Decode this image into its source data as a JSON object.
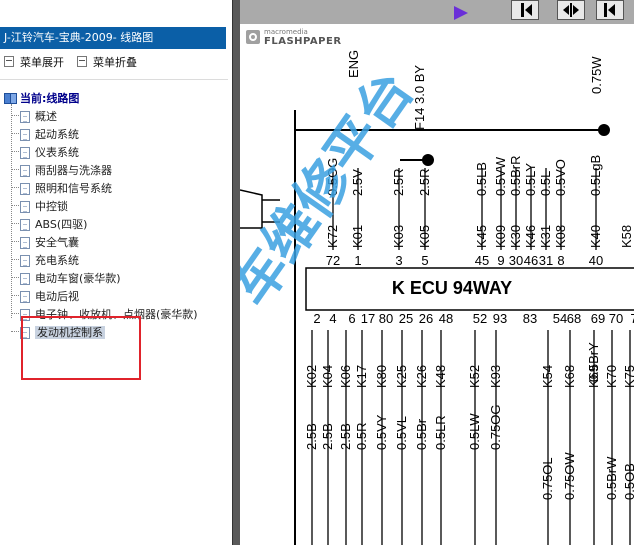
{
  "window": {
    "title": "J-江铃汽车-宝典-2009- 线路图"
  },
  "menu_controls": {
    "expand": "菜单展开",
    "collapse": "菜单折叠"
  },
  "tree": {
    "root": "当前:线路图",
    "items": [
      "概述",
      "起动系统",
      "仪表系统",
      "雨刮器与洗涤器",
      "照明和信号系统",
      "中控锁",
      "ABS(四驱)",
      "安全气囊",
      "充电系统",
      "电动车窗(豪华款)",
      "电动后视",
      "电子钟、收放机、点烟器(豪华款)",
      "发动机控制系"
    ],
    "selected_index": 12
  },
  "viewer": {
    "brand_small": "macromedia",
    "brand_large": "FLASHPAPER"
  },
  "diagram": {
    "ecu_label": "K   ECU 94WAY",
    "top_wires": [
      "0.5OG",
      "2.5V",
      "2.5R",
      "2.5R",
      "0.5LB",
      "0.5VW",
      "0.5BrR",
      "0.5LY",
      "0.5L",
      "0.5VO",
      "0.5LgB"
    ],
    "top_codes": [
      "K72",
      "K01",
      "K03",
      "K05",
      "K45",
      "K09",
      "K30",
      "K46",
      "K31",
      "K08",
      "K40",
      "K58"
    ],
    "top_pins": [
      "72",
      "1",
      "3",
      "5",
      "45",
      "9",
      "30",
      "46",
      "31",
      "8",
      "40"
    ],
    "top_extra": [
      "ENG",
      "F14 3.0 BY",
      "0.75W"
    ],
    "bottom_pins": [
      "2",
      "4",
      "6",
      "17",
      "80",
      "25",
      "26",
      "48",
      "52",
      "93",
      "83",
      "54",
      "68",
      "69",
      "70",
      "7"
    ],
    "bottom_codes": [
      "K02",
      "K04",
      "K06",
      "K17",
      "K80",
      "K25",
      "K26",
      "K48",
      "K52",
      "K93",
      "K54",
      "K68",
      "K69",
      "K70",
      "K75"
    ],
    "bottom_wires": [
      "2.5B",
      "2.5B",
      "2.5B",
      "0.5R",
      "0.5VY",
      "0.5VL",
      "0.5Br",
      "0.5LR",
      "0.5LW",
      "0.75OG",
      "0.5BrY",
      "0.75OL",
      "0.75OW",
      "0.5BrW",
      "0.5OB"
    ],
    "watermark": "车维修平台"
  }
}
